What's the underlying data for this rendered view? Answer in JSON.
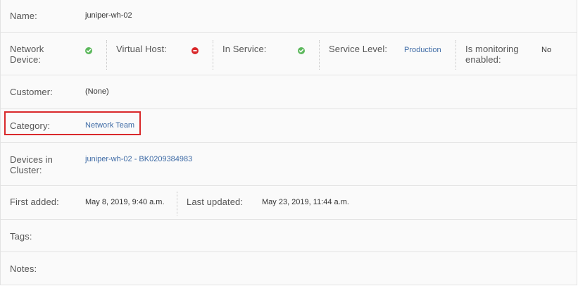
{
  "device": {
    "name_label": "Name:",
    "name_value": "juniper-wh-02",
    "network_device_label_1": "Network",
    "network_device_label_2": "Device:",
    "virtual_host_label": "Virtual Host:",
    "in_service_label": "In Service:",
    "service_level_label": "Service Level:",
    "service_level_value": "Production",
    "monitoring_label_1": "Is monitoring",
    "monitoring_label_2": "enabled:",
    "monitoring_value": "No",
    "customer_label": "Customer:",
    "customer_value": "(None)",
    "category_label": "Category:",
    "category_value": "Network Team",
    "cluster_label_1": "Devices in",
    "cluster_label_2": "Cluster:",
    "cluster_value": "juniper-wh-02 - BK0209384983",
    "first_added_label": "First added:",
    "first_added_value": "May 8, 2019, 9:40 a.m.",
    "last_updated_label": "Last updated:",
    "last_updated_value": "May 23, 2019, 11:44 a.m.",
    "tags_label": "Tags:",
    "notes_label": "Notes:"
  },
  "status": {
    "network_device": "yes-icon",
    "virtual_host": "no-icon",
    "in_service": "yes-icon"
  },
  "colors": {
    "yes": "#5cb85c",
    "no": "#d9292b",
    "link": "#3d6aa5",
    "highlight": "#d9292b"
  }
}
